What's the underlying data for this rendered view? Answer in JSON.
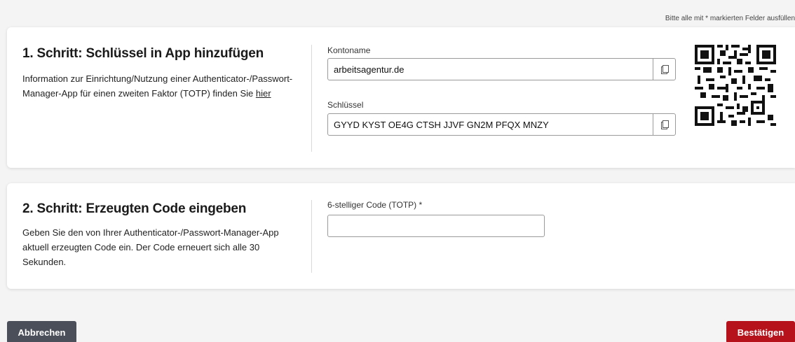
{
  "required_note": "Bitte alle mit * markierten Felder ausfüllen",
  "step1": {
    "title": "1. Schritt: Schlüssel in App hinzufügen",
    "desc_text": "Information zur Einrichtung/Nutzung einer Authenticator-/Passwort-Manager-App für einen zweiten Faktor (TOTP) finden Sie",
    "link_text": "hier",
    "account_label": "Kontoname",
    "account_value": "arbeitsagentur.de",
    "key_label": "Schlüssel",
    "key_value": "GYYD KYST OE4G CTSH JJVF GN2M PFQX MNZY"
  },
  "step2": {
    "title": "2. Schritt: Erzeugten Code eingeben",
    "desc": "Geben Sie den von Ihrer Authenticator-/Passwort-Manager-App aktuell erzeugten Code ein. Der Code erneuert sich alle 30 Sekunden.",
    "code_label": "6-stelliger Code (TOTP) *",
    "code_value": ""
  },
  "buttons": {
    "cancel": "Abbrechen",
    "confirm": "Bestätigen"
  },
  "icons": {
    "copy": "copy-icon",
    "qr": "qr-code"
  },
  "colors": {
    "cancel_bg": "#4a4f5a",
    "confirm_bg": "#b5121b"
  }
}
